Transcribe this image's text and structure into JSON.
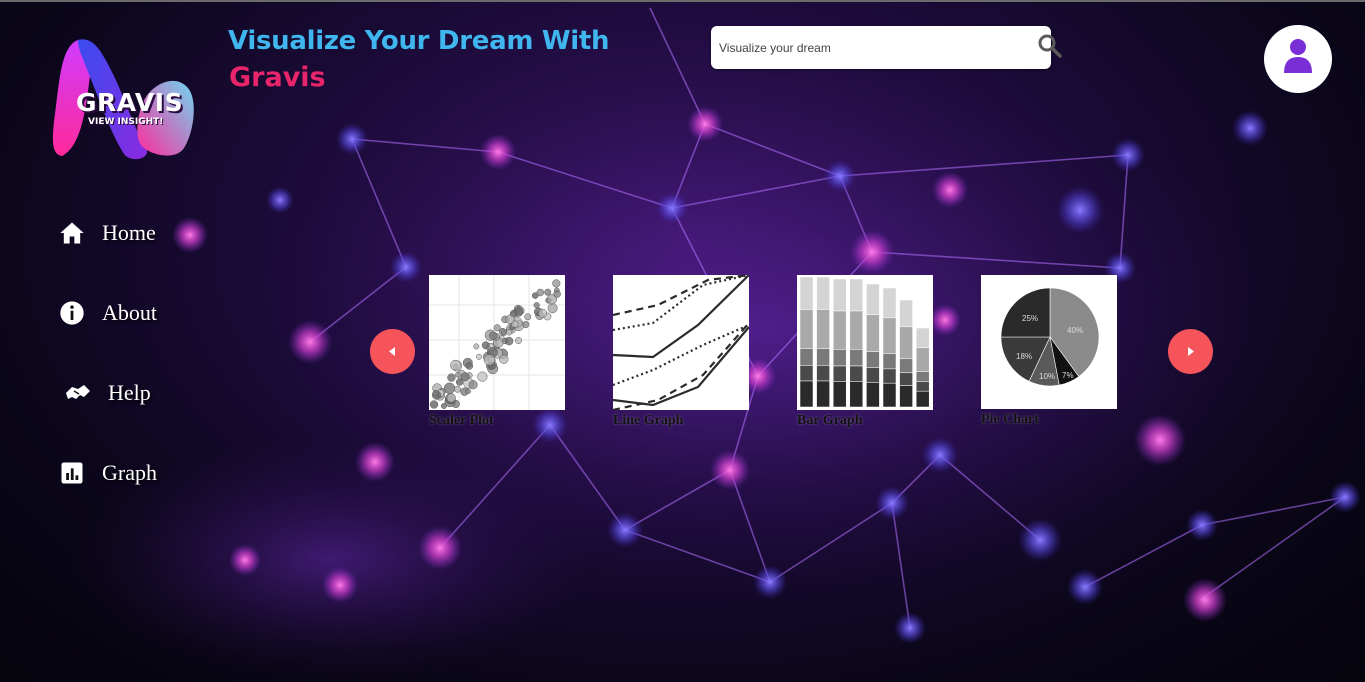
{
  "brand": {
    "name": "GRAVIS",
    "tagline": "VIEW INSIGHT!",
    "colors": {
      "pink": "#ff2a9a",
      "blue": "#3a4cf0",
      "cyan": "#6fd7f2"
    }
  },
  "header": {
    "title_line1": "Visualize Your Dream With",
    "title_line2": "Gravis",
    "title_color1": "#3fb6ee",
    "title_color2": "#e8246a"
  },
  "search": {
    "placeholder": "Visualize your dream",
    "value": "",
    "icon": "magnifier-icon"
  },
  "user": {
    "icon": "user-icon",
    "icon_color": "#7a2fd6"
  },
  "nav": {
    "items": [
      {
        "label": "Home",
        "icon": "home-icon"
      },
      {
        "label": "About",
        "icon": "info-icon"
      },
      {
        "label": "Help",
        "icon": "handshake-icon"
      },
      {
        "label": "Graph",
        "icon": "bar-chart-icon"
      }
    ]
  },
  "carousel": {
    "prev_icon": "caret-left-icon",
    "next_icon": "caret-right-icon",
    "accent": "#f5545a",
    "cards": [
      {
        "label": "Scaler Plot",
        "kind": "scatter"
      },
      {
        "label": "Line Graph",
        "kind": "line"
      },
      {
        "label": "Bar Graph",
        "kind": "bar"
      },
      {
        "label": "Pie Chart",
        "kind": "pie"
      }
    ],
    "pie_slices": [
      "40%",
      "7%",
      "10%",
      "18%",
      "25%"
    ]
  }
}
